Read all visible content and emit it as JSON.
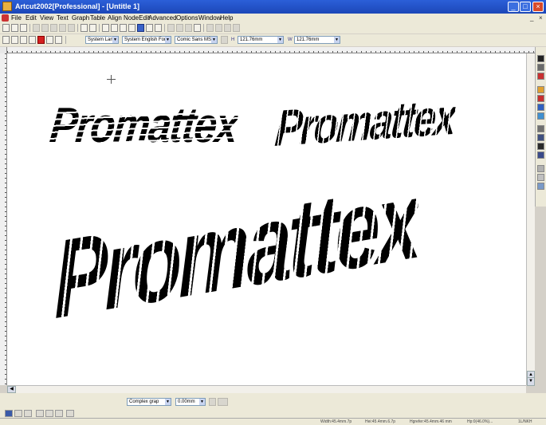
{
  "window": {
    "title": "Artcut2002[Professional] - [Untitle 1]",
    "min_label": "_",
    "max_label": "□",
    "close_label": "×"
  },
  "menu": {
    "items": [
      "File",
      "Edit",
      "View",
      "Text",
      "Graph",
      "Table",
      "Align",
      "NodeEdit",
      "Advanced",
      "Options",
      "Window",
      "Help"
    ],
    "mdi_min": "_",
    "mdi_close": "×"
  },
  "toolbar2": {
    "lang_combo": "System Lan",
    "font_lang_combo": "System English For",
    "font_combo": "Comic Sans MS",
    "height_label": "H",
    "height_value": "121.76mm",
    "width_label": "W",
    "width_value": "121.76mm"
  },
  "canvas": {
    "text_top_left": "Promattex",
    "text_top_right": "Promattex",
    "text_large": "Promattex"
  },
  "bottom": {
    "mode_combo": "Complex grap",
    "offset_combo": "0.00mm"
  },
  "status": {
    "cells": [
      "Width:45.4mm.7p",
      "Hei:45.4mm.6.7p",
      "Hgrefer:45.4mm.46 mm",
      "Hp:0(46.0%)...",
      "1L/NKH"
    ]
  },
  "colors": {
    "titlebar": "#1c47b8",
    "chrome": "#ece9d8",
    "canvas": "#ffffff",
    "ink": "#000000"
  }
}
